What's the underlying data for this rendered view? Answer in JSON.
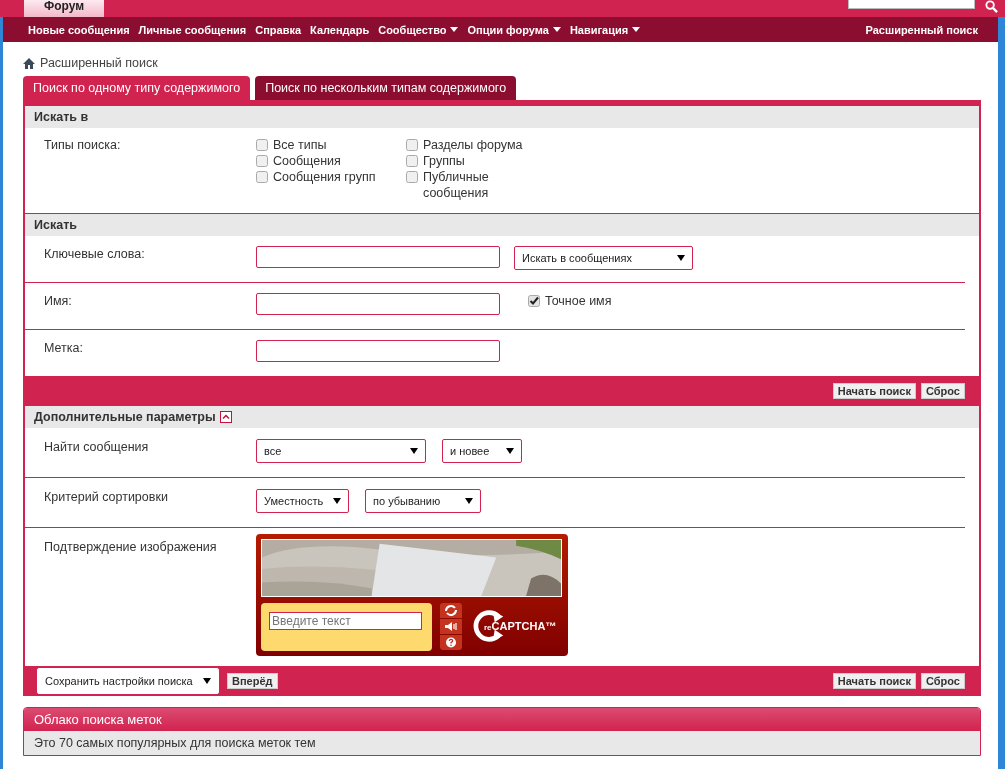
{
  "header": {
    "tab": "Форум"
  },
  "nav": {
    "items": [
      {
        "label": "Новые сообщения",
        "dropdown": false
      },
      {
        "label": "Личные сообщения",
        "dropdown": false
      },
      {
        "label": "Справка",
        "dropdown": false
      },
      {
        "label": "Календарь",
        "dropdown": false
      },
      {
        "label": "Сообщество",
        "dropdown": true
      },
      {
        "label": "Опции форума",
        "dropdown": true
      },
      {
        "label": "Навигация",
        "dropdown": true
      }
    ],
    "right": "Расширенный поиск"
  },
  "breadcrumb": "Расширенный поиск",
  "tabs": [
    {
      "label": "Поиск по одному типу содержимого",
      "selected": true
    },
    {
      "label": "Поиск по нескольким типам содержимого",
      "selected": false
    }
  ],
  "search_in": {
    "title": "Искать в",
    "label": "Типы поиска:",
    "columns": [
      [
        {
          "label": "Все типы",
          "checked": false
        },
        {
          "label": "Сообщения",
          "checked": false
        },
        {
          "label": "Сообщения групп",
          "checked": false
        }
      ],
      [
        {
          "label": "Разделы форума",
          "checked": false
        },
        {
          "label": "Группы",
          "checked": false
        },
        {
          "label": "Публичные сообщения",
          "checked": false
        }
      ]
    ]
  },
  "search": {
    "title": "Искать",
    "rows": [
      {
        "label": "Ключевые слова:",
        "select": "Искать в сообщениях"
      },
      {
        "label": "Имя:",
        "checkbox": {
          "label": "Точное имя",
          "checked": true
        }
      },
      {
        "label": "Метка:"
      }
    ]
  },
  "buttons": [
    "Начать поиск",
    "Сброс"
  ],
  "advanced": {
    "title": "Дополнительные параметры",
    "expanded": true,
    "rows": [
      {
        "kind": "selects",
        "label": "Найти сообщения",
        "selects": [
          "все",
          "и новее"
        ]
      },
      {
        "kind": "selects",
        "label": "Критерий сортировки",
        "selects": [
          "Уместность",
          "по убыванию"
        ]
      },
      {
        "kind": "captcha",
        "label": "Подтверждение изображения",
        "placeholder": "Введите текст",
        "logo": "CAPTCHA™",
        "logo_prefix": "re"
      }
    ]
  },
  "footer_bar": {
    "select": "Сохранить настройки поиска",
    "go": "Вперёд",
    "buttons": [
      "Начать поиск",
      "Сброс"
    ]
  },
  "tag_cloud": {
    "title": "Облако поиска меток",
    "text": "Это 70 самых популярных для поиска меток тем"
  }
}
